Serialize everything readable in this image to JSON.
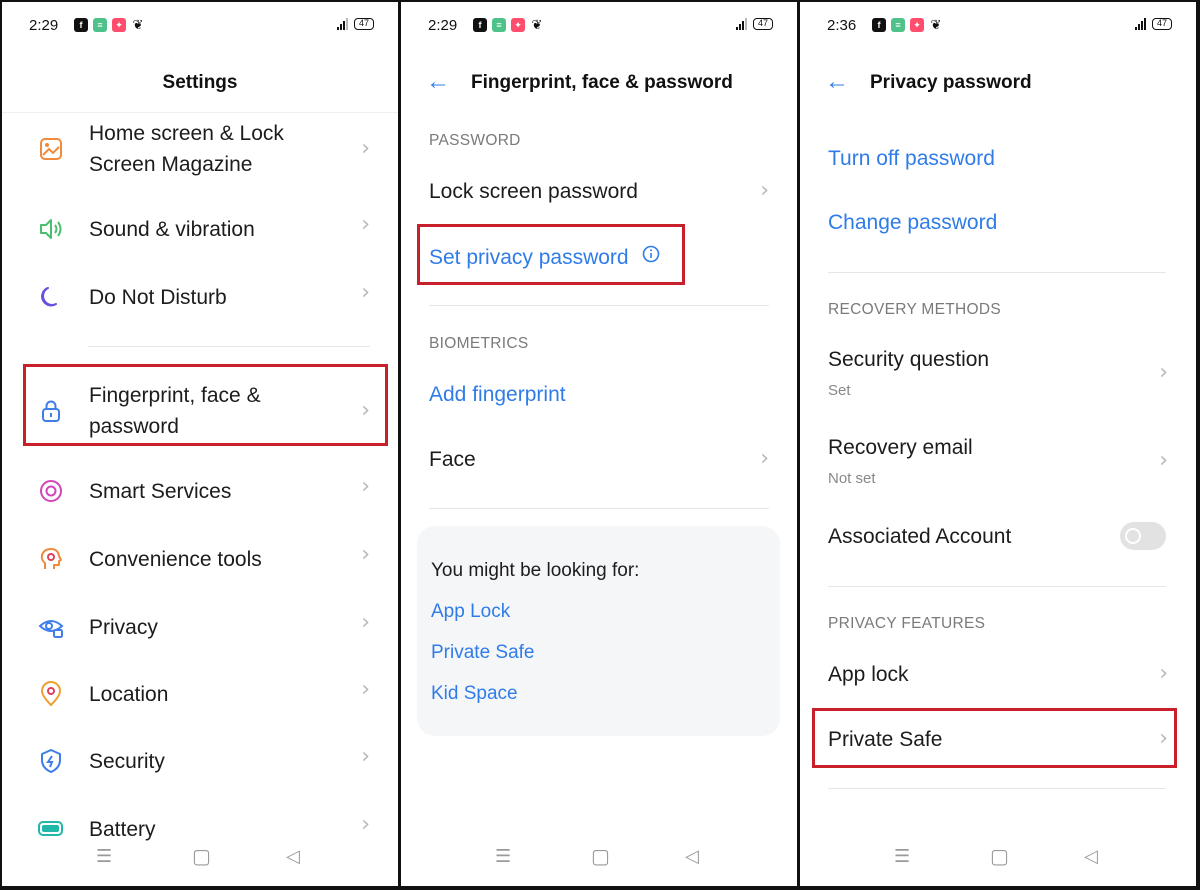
{
  "panel1": {
    "status": {
      "time": "2:29",
      "battery": "47"
    },
    "title": "Settings",
    "items": [
      {
        "label_line1": "Home screen & Lock",
        "label_line2": "Screen Magazine",
        "icon": "wallpaper-icon"
      },
      {
        "label": "Sound & vibration",
        "icon": "speaker-icon"
      },
      {
        "label": "Do Not Disturb",
        "icon": "moon-icon"
      },
      {
        "label_line1": "Fingerprint, face &",
        "label_line2": "password",
        "icon": "lock-icon"
      },
      {
        "label": "Smart Services",
        "icon": "smart-services-icon"
      },
      {
        "label": "Convenience tools",
        "icon": "convenience-tools-icon"
      },
      {
        "label": "Privacy",
        "icon": "eye-lock-icon"
      },
      {
        "label": "Location",
        "icon": "location-pin-icon"
      },
      {
        "label": "Security",
        "icon": "shield-icon"
      },
      {
        "label": "Battery",
        "icon": "battery-icon"
      }
    ]
  },
  "panel2": {
    "status": {
      "time": "2:29",
      "battery": "47"
    },
    "title": "Fingerprint, face & password",
    "password_section": "PASSWORD",
    "lock_screen_password": "Lock screen password",
    "set_privacy_password": "Set privacy password",
    "biometrics_section": "BIOMETRICS",
    "add_fingerprint": "Add fingerprint",
    "face": "Face",
    "suggest": {
      "title": "You might be looking for:",
      "links": [
        "App Lock",
        "Private Safe",
        "Kid Space"
      ]
    }
  },
  "panel3": {
    "status": {
      "time": "2:36",
      "battery": "47"
    },
    "title": "Privacy password",
    "turn_off": "Turn off password",
    "change": "Change password",
    "recovery_section": "RECOVERY METHODS",
    "security_question": "Security question",
    "security_question_value": "Set",
    "recovery_email": "Recovery email",
    "recovery_email_value": "Not set",
    "associated_account": "Associated Account",
    "privacy_section": "PRIVACY FEATURES",
    "app_lock": "App lock",
    "private_safe": "Private Safe"
  },
  "colors": {
    "accent": "#2f7ce8",
    "highlight": "#c8202a"
  }
}
